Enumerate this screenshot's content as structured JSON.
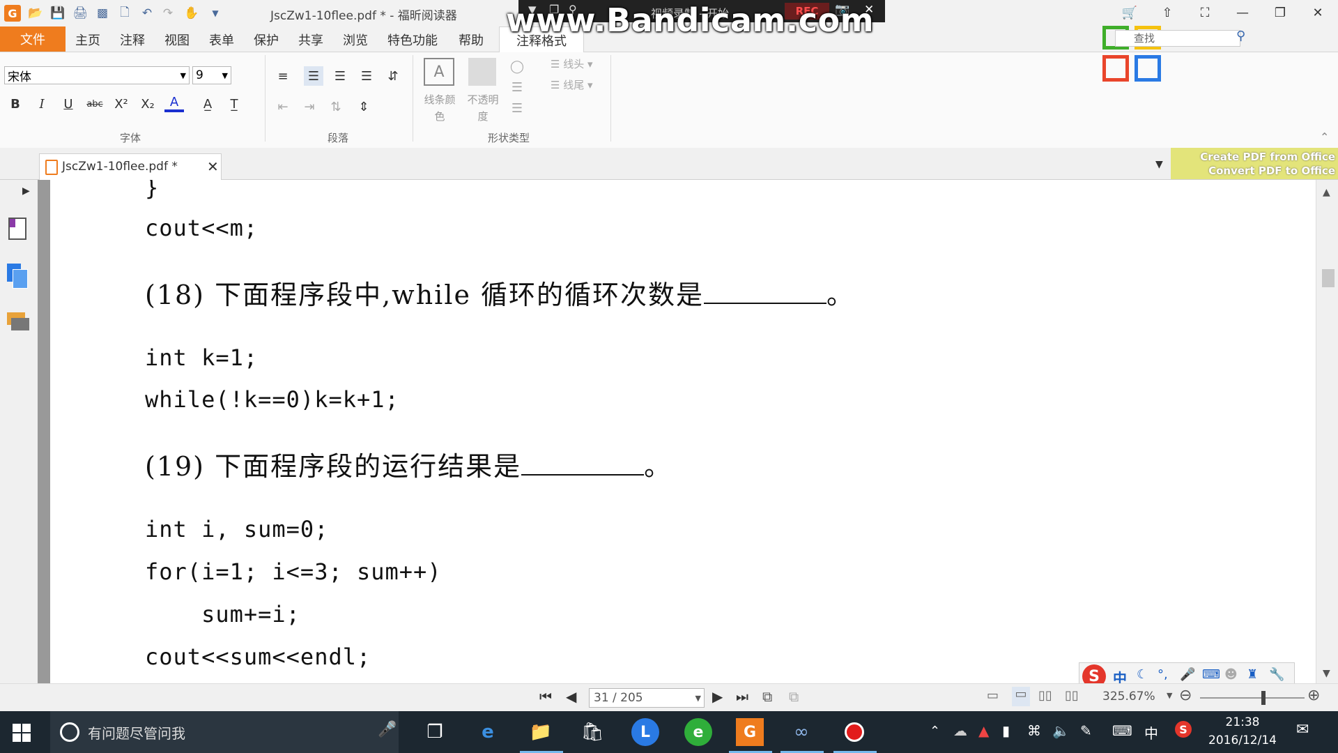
{
  "title_bar": {
    "window_title": "JscZw1-10flee.pdf * - 福昕阅读器",
    "logo_letter": "G",
    "quick_icons": [
      "open-folder-icon",
      "save-icon",
      "print-icon",
      "scan-icon",
      "new-doc-icon",
      "undo-icon",
      "redo-icon",
      "hand-tool-icon",
      "customize-arrow-icon"
    ]
  },
  "recorder": {
    "watermark": "www.Bandicam.com",
    "title": "视频录制 - 开始",
    "rec_label": "REC"
  },
  "menu": {
    "file": "文件",
    "items": [
      "主页",
      "注释",
      "视图",
      "表单",
      "保护",
      "共享",
      "浏览",
      "特色功能",
      "帮助"
    ],
    "active_tab": "注释格式"
  },
  "ribbon": {
    "font_name": "宋体",
    "font_size": "9",
    "group_font": "字体",
    "group_paragraph": "段落",
    "group_shape": "形状类型",
    "line_color_label": "线条颜色",
    "opacity_label": "不透明度",
    "line_head": "线头",
    "line_tail": "线尾",
    "search_placeholder": "查找"
  },
  "doc_tab": {
    "label": "JscZw1-10flee.pdf *"
  },
  "promo": {
    "line1": "Create PDF from Office",
    "line2": "Convert PDF to Office"
  },
  "document": {
    "brace": "}",
    "line_cout_m": "cout<<m;",
    "q18_text": "(18) 下面程序段中,while 循环的循环次数是",
    "q18_end": "。",
    "q18_code1": "int k=1;",
    "q18_code2": "while(!k==0)k=k+1;",
    "q19_text": "(19) 下面程序段的运行结果是",
    "q19_end": "。",
    "q19_code1": "int i, sum=0;",
    "q19_code2": "for(i=1; i<=3; sum++)",
    "q19_code3": "    sum+=i;",
    "q19_code4": "cout<<sum<<endl;"
  },
  "status": {
    "page_indicator": "31 / 205",
    "zoom": "325.67%"
  },
  "ime": {
    "mode": "中"
  },
  "taskbar": {
    "search_placeholder": "有问题尽管问我",
    "ime_indicator": "中",
    "time": "21:38",
    "date": "2016/12/14"
  }
}
